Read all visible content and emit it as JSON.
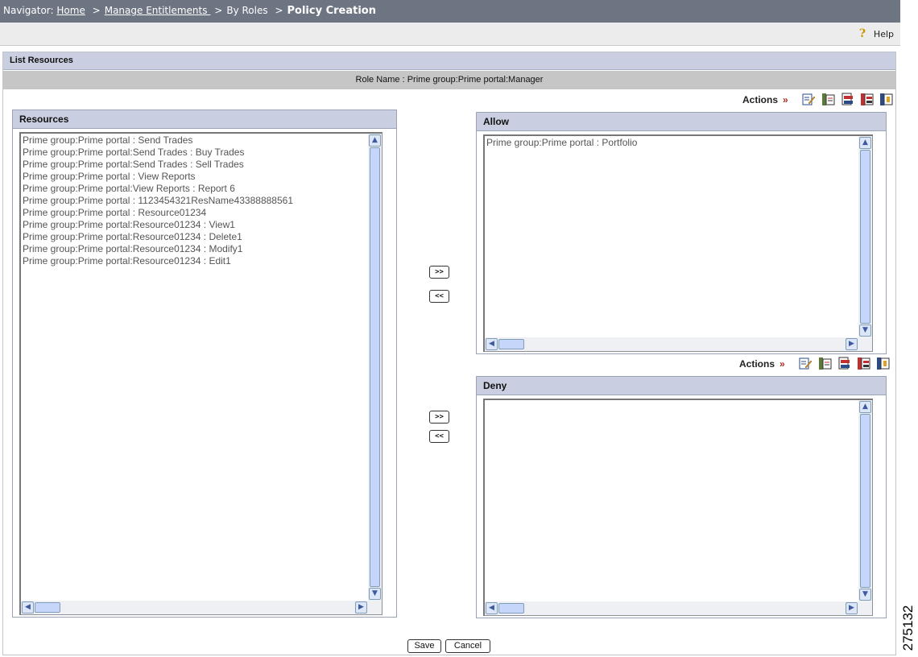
{
  "navigator": {
    "label": "Navigator:",
    "home": "Home",
    "manage": "Manage Entitlements ",
    "by_roles": "By Roles",
    "current": "Policy Creation",
    "sep": ">"
  },
  "help": {
    "label": "Help",
    "icon": "help-icon"
  },
  "section_title": "List Resources",
  "role_name": "Role Name : Prime group:Prime portal:Manager",
  "actions_label": "Actions",
  "actions_chevron": "»",
  "resources": {
    "title": "Resources",
    "items": [
      "Prime group:Prime portal : Send Trades",
      "Prime group:Prime portal:Send Trades : Buy Trades",
      "Prime group:Prime portal:Send Trades : Sell Trades",
      "Prime group:Prime portal : View Reports",
      "Prime group:Prime portal:View Reports : Report 6",
      "Prime group:Prime portal : 1123454321ResName43388888561",
      "Prime group:Prime portal : Resource01234",
      "Prime group:Prime portal:Resource01234 : View1",
      "Prime group:Prime portal:Resource01234 : Delete1",
      "Prime group:Prime portal:Resource01234 : Modify1",
      "Prime group:Prime portal:Resource01234 : Edit1"
    ]
  },
  "allow": {
    "title": "Allow",
    "items": [
      "Prime group:Prime portal : Portfolio"
    ]
  },
  "deny": {
    "title": "Deny",
    "items": []
  },
  "move_right": ">>",
  "move_left": "<<",
  "buttons": {
    "save": "Save",
    "cancel": "Cancel"
  },
  "figure_number": "275132"
}
